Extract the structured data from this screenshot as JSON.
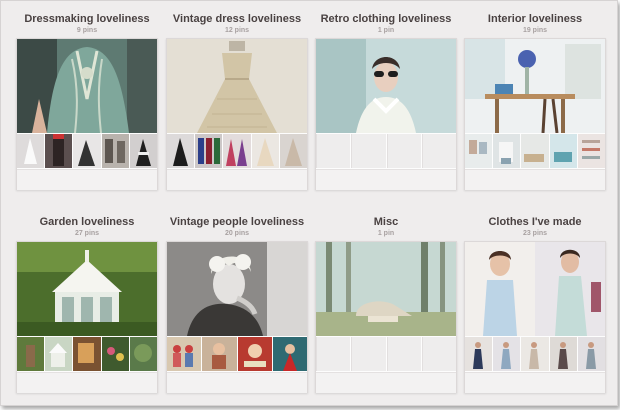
{
  "boards": [
    {
      "title": "Dressmaking loveliness",
      "pin_count": "9 pins",
      "cover": "teal beaded couture dress back",
      "thumbs": [
        "white gown",
        "dark dress",
        "black lace gown",
        "sepia fashion photo",
        "black and white dress"
      ]
    },
    {
      "title": "Vintage dress loveliness",
      "pin_count": "12 pins",
      "cover": "strapless embroidered ivory gown",
      "thumbs": [
        "black dresses",
        "colorful dresses",
        "pink dresses",
        "pale dresses",
        "cream gowns"
      ]
    },
    {
      "title": "Retro clothing loveliness",
      "pin_count": "1 pin",
      "cover": "woman in white collar blouse and sunglasses",
      "thumbs": []
    },
    {
      "title": "Interior loveliness",
      "pin_count": "19 pins",
      "cover": "white interior with blue flowers and desk",
      "thumbs": [
        "bright interior",
        "living room",
        "hallway",
        "bedroom",
        "shelves"
      ]
    },
    {
      "title": "Garden loveliness",
      "pin_count": "27 pins",
      "cover": "white greenhouse in garden",
      "thumbs": [
        "garden path",
        "white shed",
        "warm interior",
        "flowers",
        "greenery"
      ]
    },
    {
      "title": "Vintage people loveliness",
      "pin_count": "20 pins",
      "cover": "black and white portrait of woman with curls",
      "thumbs": [
        "vintage couple",
        "retro women",
        "vintage ad",
        "woman in red"
      ]
    },
    {
      "title": "Misc",
      "pin_count": "1 pin",
      "cover": "misty forest with retro chair",
      "thumbs": []
    },
    {
      "title": "Clothes I've made",
      "pin_count": "23 pins",
      "cover": "woman in handmade light blue dress",
      "thumbs": [
        "dress 1",
        "dress 2",
        "dress 3",
        "dress 4",
        "dress 5"
      ]
    }
  ],
  "colors": {
    "background": "#efeded",
    "title": "#4a4242",
    "count": "#a8a1a1",
    "card": "#fdfdfd"
  }
}
